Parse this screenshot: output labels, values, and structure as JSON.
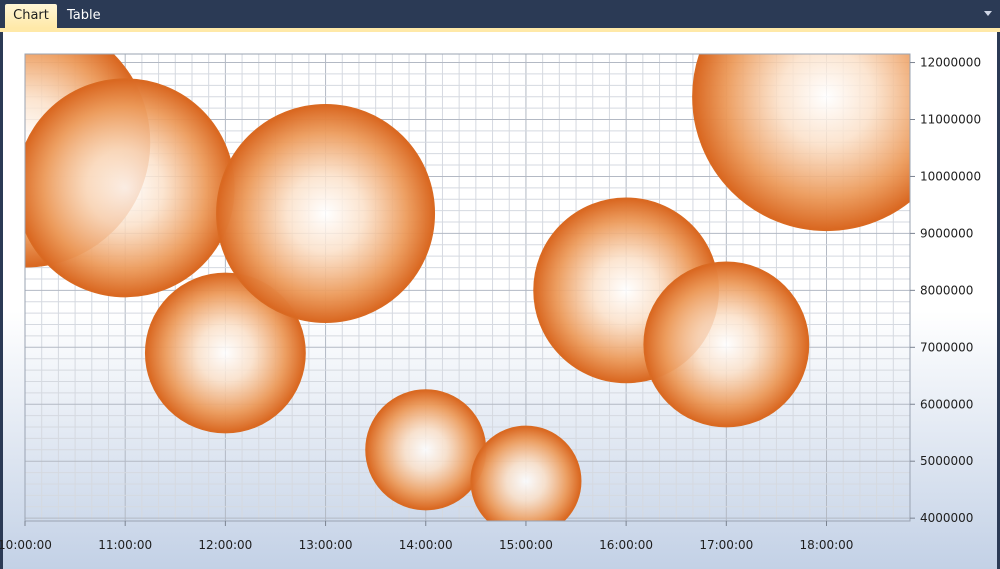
{
  "tabs": [
    {
      "label": "Chart",
      "active": true
    },
    {
      "label": "Table",
      "active": false
    }
  ],
  "chart_data": {
    "type": "scatter",
    "variant": "bubble",
    "x_ticks": [
      "10:00:00",
      "11:00:00",
      "12:00:00",
      "13:00:00",
      "14:00:00",
      "15:00:00",
      "16:00:00",
      "17:00:00",
      "18:00:00"
    ],
    "y_ticks": [
      4000000,
      5000000,
      6000000,
      7000000,
      8000000,
      9000000,
      10000000,
      11000000,
      12000000
    ],
    "xlim": [
      "10:00:00",
      "18:50:00"
    ],
    "ylim": [
      3950000,
      12150000
    ],
    "y_axis_position": "right",
    "grid": true,
    "bubble_color": "#e07a2f",
    "series": [
      {
        "points": [
          {
            "x": "10:00:00",
            "y": 10600000,
            "size": 1.5
          },
          {
            "x": "11:00:00",
            "y": 9800000,
            "size": 1.31
          },
          {
            "x": "12:00:00",
            "y": 6900000,
            "size": 0.96
          },
          {
            "x": "13:00:00",
            "y": 9350000,
            "size": 1.31
          },
          {
            "x": "14:00:00",
            "y": 5200000,
            "size": 0.72
          },
          {
            "x": "15:00:00",
            "y": 4650000,
            "size": 0.66
          },
          {
            "x": "16:00:00",
            "y": 8000000,
            "size": 1.11
          },
          {
            "x": "17:00:00",
            "y": 7050000,
            "size": 0.99
          },
          {
            "x": "18:00:00",
            "y": 11400000,
            "size": 1.61
          }
        ]
      }
    ]
  }
}
